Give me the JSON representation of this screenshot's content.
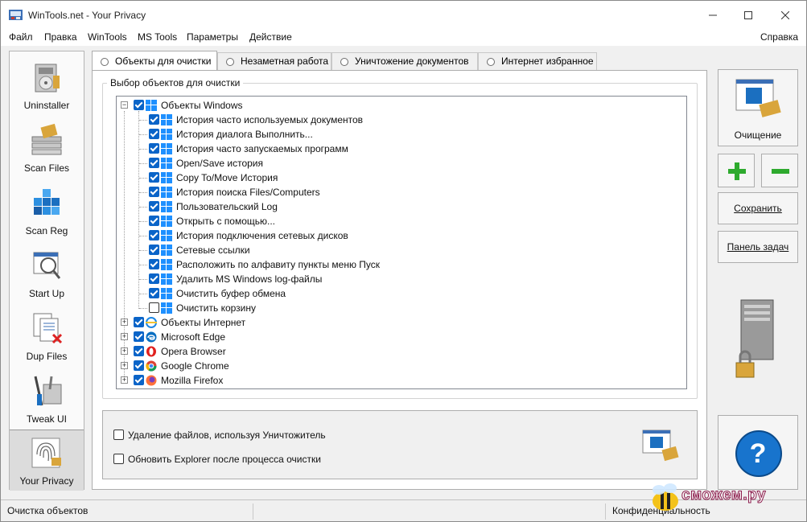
{
  "window": {
    "title": "WinTools.net - Your Privacy"
  },
  "menu": [
    "Файл",
    "Правка",
    "WinTools",
    "MS Tools",
    "Параметры",
    "Действие"
  ],
  "menu_help": "Справка",
  "sidebar": [
    {
      "label": "Uninstaller",
      "icon": "uninstaller-icon"
    },
    {
      "label": "Scan Files",
      "icon": "scan-files-icon"
    },
    {
      "label": "Scan Reg",
      "icon": "scan-reg-icon"
    },
    {
      "label": "Start Up",
      "icon": "startup-icon"
    },
    {
      "label": "Dup Files",
      "icon": "dup-files-icon"
    },
    {
      "label": "Tweak UI",
      "icon": "tweak-ui-icon"
    },
    {
      "label": "Your Privacy",
      "icon": "privacy-icon",
      "active": true
    }
  ],
  "tabs": [
    {
      "label": "Объекты для очистки",
      "active": true
    },
    {
      "label": "Незаметная работа"
    },
    {
      "label": "Уничтожение документов"
    },
    {
      "label": "Интернет избранное"
    }
  ],
  "group_title": "Выбор объектов для очистки",
  "tree": {
    "root": {
      "label": "Объекты Windows",
      "checked": true,
      "expanded": true
    },
    "children": [
      {
        "label": "История часто используемых документов",
        "checked": true
      },
      {
        "label": "История диалога Выполнить...",
        "checked": true
      },
      {
        "label": "История часто запускаемых программ",
        "checked": true
      },
      {
        "label": "Open/Save история",
        "checked": true
      },
      {
        "label": "Copy To/Move История",
        "checked": true
      },
      {
        "label": "История поиска Files/Computers",
        "checked": true
      },
      {
        "label": "Пользовательский Log",
        "checked": true
      },
      {
        "label": "Открыть с помощью...",
        "checked": true
      },
      {
        "label": "История подключения сетевых дисков",
        "checked": true
      },
      {
        "label": "Сетевые ссылки",
        "checked": true
      },
      {
        "label": "Расположить по алфавиту пункты меню Пуск",
        "checked": true
      },
      {
        "label": "Удалить MS Windows log-файлы",
        "checked": true
      },
      {
        "label": "Очистить буфер обмена",
        "checked": true
      },
      {
        "label": "Очистить корзину",
        "checked": false
      }
    ],
    "others": [
      {
        "label": "Объекты Интернет",
        "checked": true,
        "icon": "ie-icon"
      },
      {
        "label": "Microsoft Edge",
        "checked": true,
        "icon": "edge-icon"
      },
      {
        "label": "Opera Browser",
        "checked": true,
        "icon": "opera-icon"
      },
      {
        "label": "Google Chrome",
        "checked": true,
        "icon": "chrome-icon"
      },
      {
        "label": "Mozilla Firefox",
        "checked": true,
        "icon": "firefox-icon"
      }
    ]
  },
  "options": [
    {
      "label": "Удаление файлов, используя Уничтожитель",
      "checked": false
    },
    {
      "label": "Обновить Explorer после процесса очистки",
      "checked": false
    }
  ],
  "right": {
    "clean_label": "Очищение",
    "add_symbol": "+",
    "remove_symbol": "−",
    "save_label": "Сохранить",
    "taskbar_label": "Панель задач",
    "help_symbol": "?"
  },
  "status": {
    "left": "Очистка объектов",
    "right": "Конфиденциальность"
  },
  "watermark_text": "сможем.ру",
  "colors": {
    "accent": "#0a64c8",
    "help_blue": "#1874cd",
    "plus_green": "#2eaa2e"
  }
}
